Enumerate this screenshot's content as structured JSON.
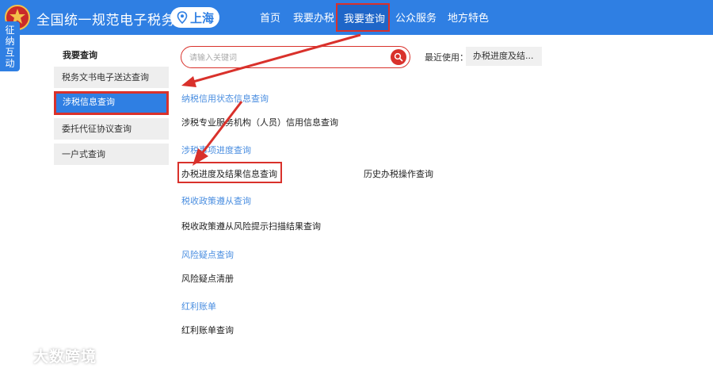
{
  "header": {
    "site_title": "全国统一规范电子税务局",
    "city": "上海",
    "nav": [
      "首页",
      "我要办税",
      "我要查询",
      "公众服务",
      "地方特色"
    ],
    "active_nav": "我要查询"
  },
  "side_tab": [
    "征",
    "纳",
    "互",
    "动"
  ],
  "sidebar": {
    "heading": "我要查询",
    "items": [
      {
        "label": "税务文书电子送达查询"
      },
      {
        "label": "涉税信息查询"
      },
      {
        "label": "委托代征协议查询"
      },
      {
        "label": "一户式查询"
      }
    ],
    "active_item": "涉税信息查询"
  },
  "search": {
    "placeholder": "请输入关键词",
    "recent_label": "最近使用：",
    "recent_chip": "办税进度及结..."
  },
  "content": {
    "categories": [
      {
        "title": "纳税信用状态信息查询",
        "links": [
          "涉税专业服务机构（人员）信用信息查询"
        ]
      },
      {
        "title": "涉税事项进度查询",
        "links": [
          "办税进度及结果信息查询",
          "历史办税操作查询"
        ]
      },
      {
        "title": "税收政策遵从查询",
        "links": [
          "税收政策遵从风险提示扫描结果查询"
        ]
      },
      {
        "title": "风险疑点查询",
        "links": [
          "风险疑点清册"
        ]
      },
      {
        "title": "红利账单",
        "links": [
          "红利账单查询"
        ]
      }
    ],
    "highlighted_link": "办税进度及结果信息查询"
  },
  "colors": {
    "header_blue": "#2f7fe3",
    "highlight_red": "#d9312b",
    "category_blue": "#4a8ee0",
    "sidebar_gray": "#eeeeee"
  },
  "icons": {
    "logo": "tax-emblem-icon",
    "location": "location-pin-icon",
    "search": "search-icon",
    "watermark": "brand-watermark-icon"
  },
  "watermark": "大数跨境"
}
